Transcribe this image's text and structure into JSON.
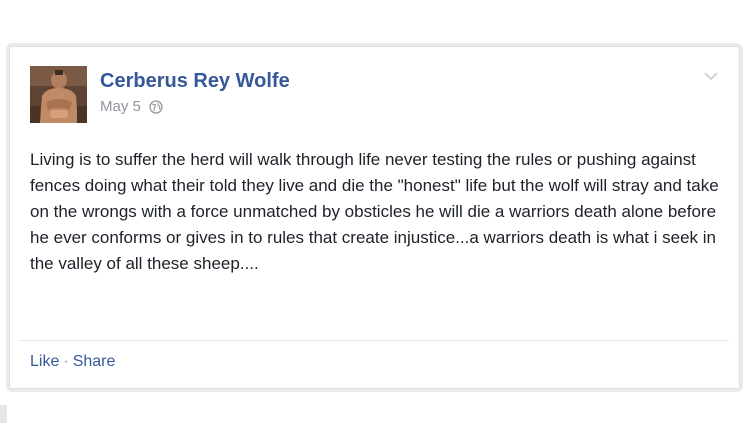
{
  "post": {
    "author": "Cerberus Rey Wolfe",
    "date": "May 5",
    "privacy_icon": "globe-icon",
    "menu_icon": "chevron-down-icon",
    "text": "Living is to suffer the herd will walk through life never testing the rules or pushing against fences doing what their told they live and die the \"honest\" life but the wolf will stray and take on the wrongs with a force unmatched by obsticles he will die a warriors death alone before he ever conforms or gives in to rules that create injustice...a warriors death is what i seek in the valley of all these sheep....",
    "actions": {
      "like": "Like",
      "separator": "·",
      "share": "Share"
    }
  },
  "colors": {
    "link": "#365899",
    "meta": "#90949c",
    "text": "#1d2129",
    "border": "#dddfe2"
  }
}
